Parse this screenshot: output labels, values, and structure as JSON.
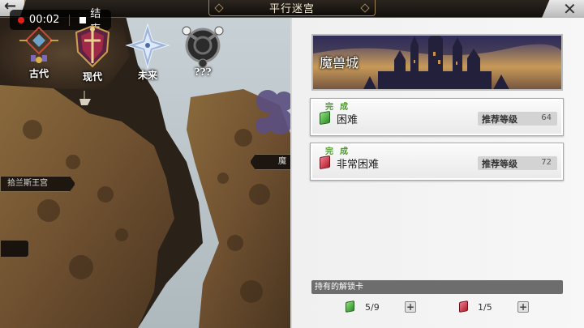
{
  "header": {
    "title": "平行迷宫",
    "back_icon": "back-arrow-icon",
    "close_icon": "close-icon"
  },
  "recorder": {
    "time": "00:02",
    "end_label": "结束"
  },
  "eras": [
    {
      "label": "古代",
      "icon": "ancient-era-icon"
    },
    {
      "label": "现代",
      "icon": "modern-era-icon"
    },
    {
      "label": "未来",
      "icon": "future-era-icon"
    },
    {
      "label": "???",
      "icon": "unknown-era-icon"
    }
  ],
  "map": {
    "palace_label": "拾兰斯王宫",
    "magic_castle_label": "魔兽城"
  },
  "panel": {
    "location_name": "魔兽城",
    "difficulties": [
      {
        "status": "完成",
        "name": "困难",
        "recommend_label": "推荐等级",
        "level": "64",
        "book_color": "#3fae38"
      },
      {
        "status": "完成",
        "name": "非常困难",
        "recommend_label": "推荐等级",
        "level": "72",
        "book_color": "#d02a3a"
      }
    ],
    "keys_label": "持有的解锁卡",
    "keys": [
      {
        "count": "5/9",
        "color": "green"
      },
      {
        "count": "1/5",
        "color": "red"
      }
    ]
  }
}
